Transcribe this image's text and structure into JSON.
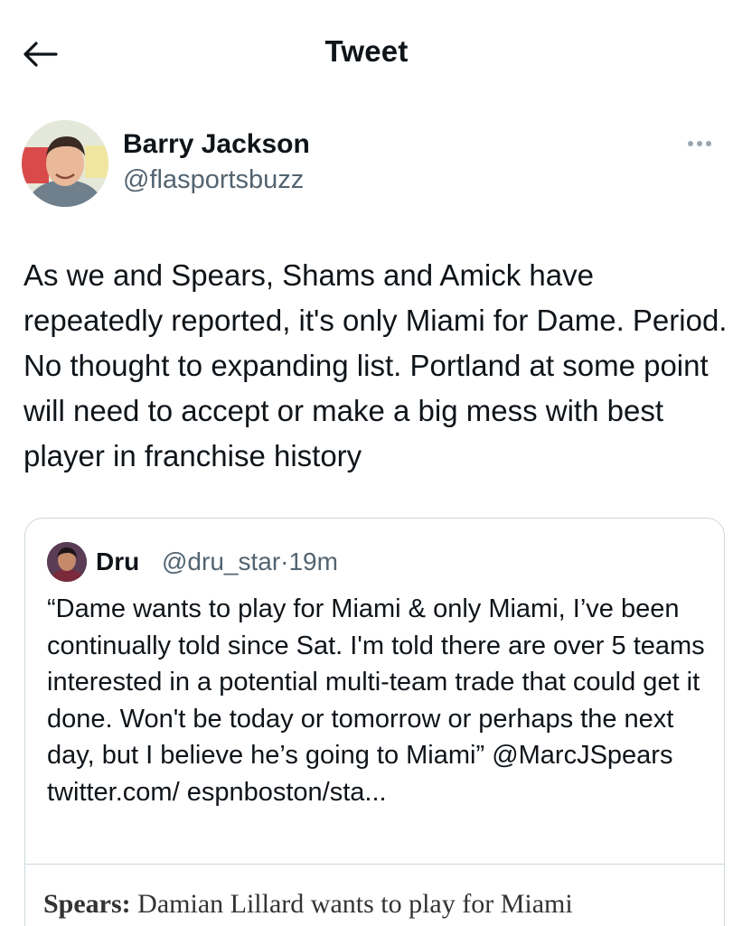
{
  "header": {
    "title": "Tweet",
    "back_icon": "arrow-left-icon"
  },
  "tweet": {
    "author_name": "Barry Jackson",
    "author_handle": "@flasportsbuzz",
    "more_icon": "more-horizontal-icon",
    "text": "As we and Spears, Shams and Amick have repeatedly reported, it's only Miami for Dame. Period. No thought to expanding list. Portland at some point will need to accept or make a big mess with best player in franchise history"
  },
  "quoted_tweet": {
    "author_name": "Dru",
    "author_handle": "@dru_star",
    "separator": "·",
    "time": "19m",
    "text": "“Dame wants to play for Miami & only Miami, I’ve been continually told since Sat. I'm told there are over 5 teams interested in a potential multi-team trade that could get it done. Won't be today or tomorrow or perhaps the next day, but I believe he’s going to Miami” @MarcJSpears twitter.com/ espnboston/sta...",
    "link_preview": {
      "label": "Spears:",
      "text": "Damian Lillard wants to play for Miami"
    }
  },
  "colors": {
    "text": "#0f1419",
    "secondary": "#536471",
    "border": "#cfd9de"
  }
}
